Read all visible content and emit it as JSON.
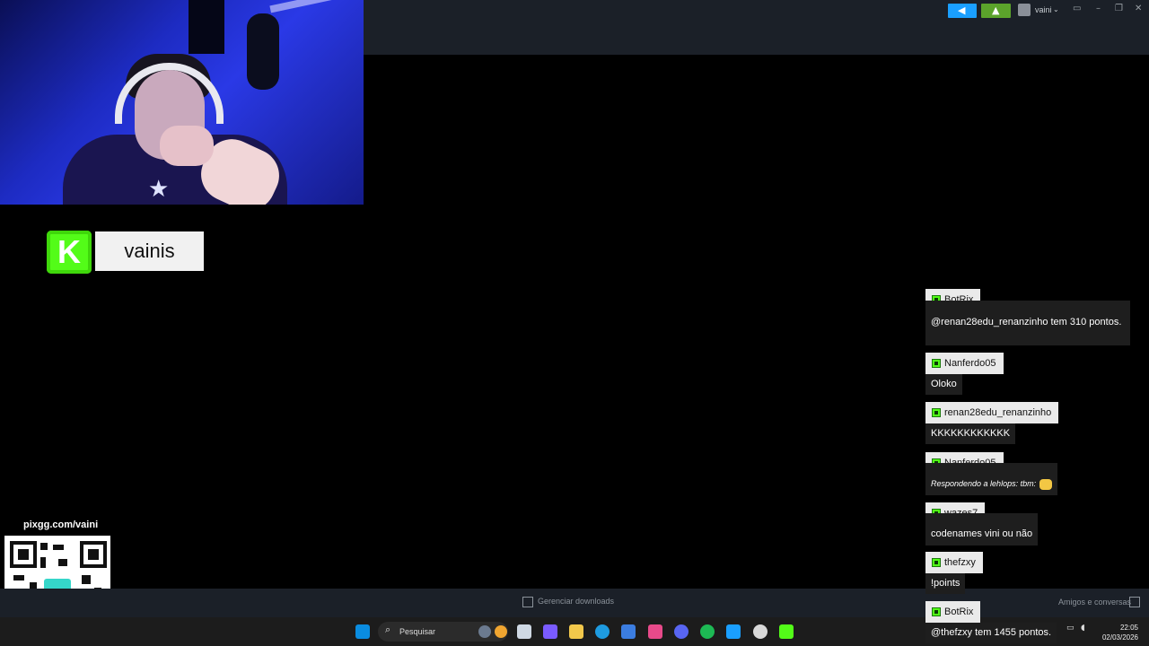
{
  "topbar": {
    "user": "vaini",
    "user_chevron": "⌄",
    "icons": {
      "broadcast": "megaphone-icon",
      "notifications": "bell-icon"
    },
    "window_controls": [
      "▭",
      "–",
      "❐",
      "✕"
    ]
  },
  "streamer_badge": {
    "platform_glyph": "K",
    "name": "vainis"
  },
  "qr": {
    "label": "pixgg.com/vaini"
  },
  "steam_bottom": {
    "downloads_label": "Gerenciar downloads",
    "friends_label": "Amigos e conversas"
  },
  "chat": {
    "messages": [
      {
        "user": "BotRix",
        "text": "@renan28edu_renanzinho tem 310 pontos.",
        "reply": false
      },
      {
        "user": "Nanferdo05",
        "text": "Oloko",
        "reply": false
      },
      {
        "user": "renan28edu_renanzinho",
        "text": "KKKKKKKKKKKK",
        "reply": false
      },
      {
        "user": "Nanferdo05",
        "text": "Respondendo a lehlops: tbm:",
        "reply": true
      },
      {
        "user": "wazes7",
        "text": "codenames vini ou não",
        "reply": false
      },
      {
        "user": "thefzxy",
        "text": "!points",
        "reply": false
      },
      {
        "user": "BotRix",
        "text": "@thefzxy tem 1455 pontos.",
        "reply": false
      }
    ]
  },
  "taskbar": {
    "search_placeholder": "Pesquisar",
    "clock_time": "22:05",
    "clock_date": "02/03/2026",
    "colors": {
      "steam": "#1a9fff",
      "spotify": "#1db954",
      "kick": "#53fc18"
    }
  }
}
